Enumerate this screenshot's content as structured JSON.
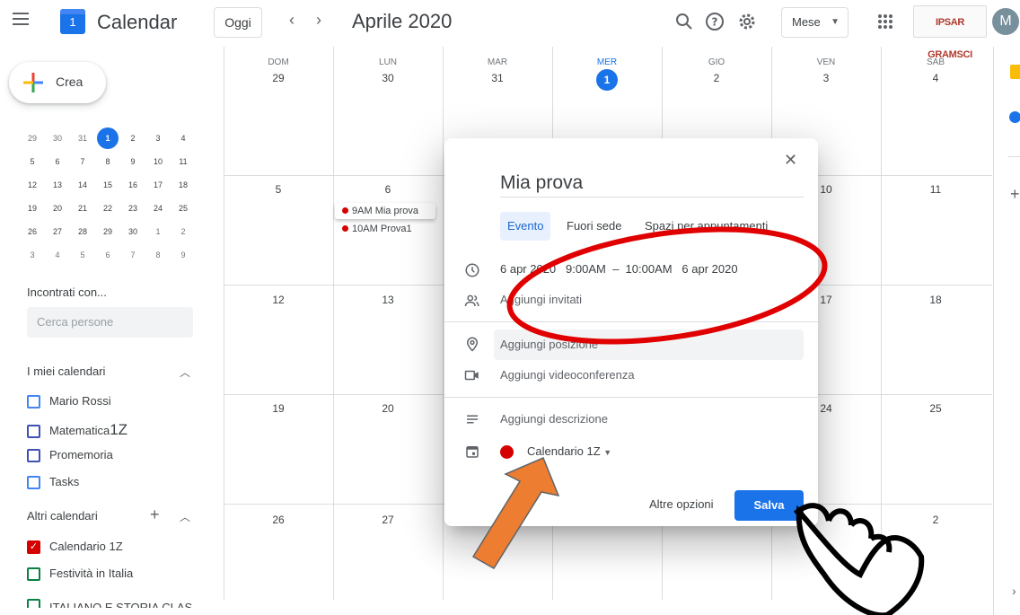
{
  "app": {
    "title": "Calendar",
    "logo_day": "1"
  },
  "toolbar": {
    "today_label": "Oggi",
    "prev_label": "‹",
    "next_label": "›",
    "month_label": "Aprile 2020",
    "view_label": "Mese",
    "org_logo_text": "IPSAR GRAMSCI",
    "avatar_initial": "M"
  },
  "sidebar": {
    "create_label": "Crea",
    "mini_calendar": {
      "rows": [
        [
          "29",
          "30",
          "31",
          "1",
          "2",
          "3",
          "4"
        ],
        [
          "5",
          "6",
          "7",
          "8",
          "9",
          "10",
          "11"
        ],
        [
          "12",
          "13",
          "14",
          "15",
          "16",
          "17",
          "18"
        ],
        [
          "19",
          "20",
          "21",
          "22",
          "23",
          "24",
          "25"
        ],
        [
          "26",
          "27",
          "28",
          "29",
          "30",
          "1",
          "2"
        ],
        [
          "3",
          "4",
          "5",
          "6",
          "7",
          "8",
          "9"
        ]
      ]
    },
    "meet_title": "Incontrati con...",
    "search_placeholder": "Cerca persone",
    "my_calendars_title": "I miei calendari",
    "my_calendars": [
      {
        "name": "Mario Rossi",
        "color": "#4285f4"
      },
      {
        "name": "Matematica",
        "suffix": "1Z",
        "color": "#3f51b5"
      },
      {
        "name": "Promemoria",
        "color": "#3f51b5"
      },
      {
        "name": "Tasks",
        "color": "#4285f4"
      }
    ],
    "other_calendars_title": "Altri calendari",
    "other_calendars": [
      {
        "name": "Calendario 1Z",
        "color": "#d50000",
        "checked": true
      },
      {
        "name": "Festività in Italia",
        "color": "#0b8043",
        "checked": false
      },
      {
        "name": "ITALIANO E STORIA CLAS",
        "color": "#0b8043",
        "checked": false
      }
    ]
  },
  "month": {
    "weekdays": [
      "DOM",
      "LUN",
      "MAR",
      "MER",
      "GIO",
      "VEN",
      "SAB"
    ],
    "first_row_days": [
      "29",
      "30",
      "31",
      "1",
      "2",
      "3",
      "4"
    ],
    "week2": [
      "5",
      "6",
      "",
      "",
      "",
      "10",
      "11"
    ],
    "week3": [
      "12",
      "13",
      "",
      "",
      "",
      "17",
      "18"
    ],
    "week4": [
      "19",
      "20",
      "",
      "",
      "",
      "24",
      "25"
    ],
    "week5": [
      "26",
      "27",
      "",
      "",
      "",
      "",
      "2"
    ],
    "events": [
      {
        "time": "9AM",
        "title": "Mia prova"
      },
      {
        "time": "10AM",
        "title": "Prova1"
      }
    ]
  },
  "dialog": {
    "title_value": "Mia prova",
    "tabs": [
      "Evento",
      "Fuori sede",
      "Spazi per appuntamenti"
    ],
    "start_date": "6 apr 2020",
    "start_time": "9:00AM",
    "dash": "–",
    "end_time": "10:00AM",
    "end_date": "6 apr 2020",
    "add_guests": "Aggiungi invitati",
    "add_location": "Aggiungi posizione",
    "add_video": "Aggiungi videoconferenza",
    "add_description": "Aggiungi descrizione",
    "calendar_name": "Calendario 1Z",
    "more_options": "Altre opzioni",
    "save_label": "Salva"
  }
}
